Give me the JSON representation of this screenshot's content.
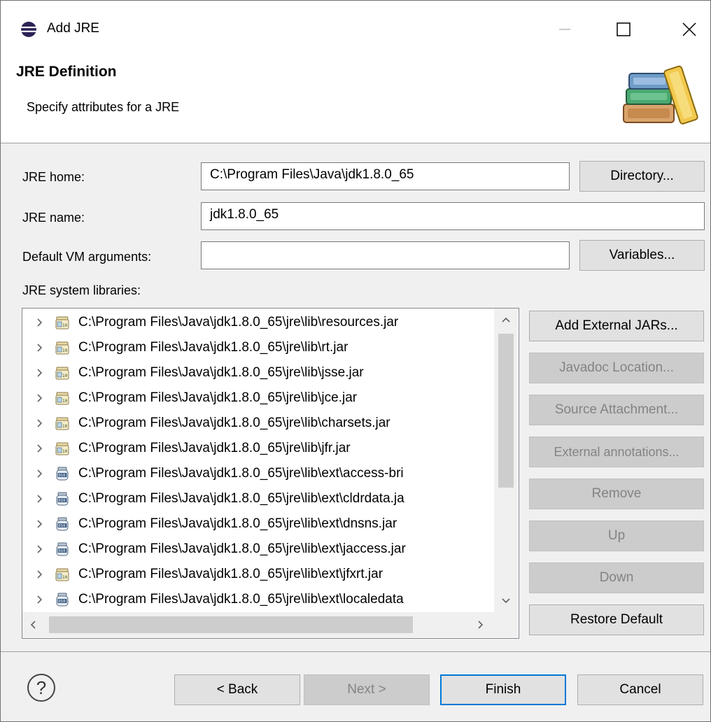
{
  "window": {
    "title": "Add JRE",
    "icon": "eclipse-icon"
  },
  "banner": {
    "title": "JRE Definition",
    "description": "Specify attributes for a JRE",
    "art": "books-icon"
  },
  "form": {
    "jre_home_label": "JRE home:",
    "jre_home_value": "C:\\Program Files\\Java\\jdk1.8.0_65",
    "directory_button": "Directory...",
    "jre_name_label": "JRE name:",
    "jre_name_value": "jdk1.8.0_65",
    "vm_args_label": "Default VM arguments:",
    "vm_args_value": "",
    "variables_button": "Variables...",
    "libraries_label": "JRE system libraries:"
  },
  "libraries": [
    {
      "path": "C:\\Program Files\\Java\\jdk1.8.0_65\\jre\\lib\\resources.jar",
      "icon": "jar-folder"
    },
    {
      "path": "C:\\Program Files\\Java\\jdk1.8.0_65\\jre\\lib\\rt.jar",
      "icon": "jar-folder"
    },
    {
      "path": "C:\\Program Files\\Java\\jdk1.8.0_65\\jre\\lib\\jsse.jar",
      "icon": "jar-folder"
    },
    {
      "path": "C:\\Program Files\\Java\\jdk1.8.0_65\\jre\\lib\\jce.jar",
      "icon": "jar-folder"
    },
    {
      "path": "C:\\Program Files\\Java\\jdk1.8.0_65\\jre\\lib\\charsets.jar",
      "icon": "jar-folder"
    },
    {
      "path": "C:\\Program Files\\Java\\jdk1.8.0_65\\jre\\lib\\jfr.jar",
      "icon": "jar-folder"
    },
    {
      "path": "C:\\Program Files\\Java\\jdk1.8.0_65\\jre\\lib\\ext\\access-bri",
      "icon": "jar-binary"
    },
    {
      "path": "C:\\Program Files\\Java\\jdk1.8.0_65\\jre\\lib\\ext\\cldrdata.ja",
      "icon": "jar-binary"
    },
    {
      "path": "C:\\Program Files\\Java\\jdk1.8.0_65\\jre\\lib\\ext\\dnsns.jar",
      "icon": "jar-binary"
    },
    {
      "path": "C:\\Program Files\\Java\\jdk1.8.0_65\\jre\\lib\\ext\\jaccess.jar",
      "icon": "jar-binary"
    },
    {
      "path": "C:\\Program Files\\Java\\jdk1.8.0_65\\jre\\lib\\ext\\jfxrt.jar",
      "icon": "jar-folder"
    },
    {
      "path": "C:\\Program Files\\Java\\jdk1.8.0_65\\jre\\lib\\ext\\localedata",
      "icon": "jar-binary"
    }
  ],
  "side_buttons": {
    "add_external_jars": "Add External JARs...",
    "javadoc_location": "Javadoc Location...",
    "source_attachment": "Source Attachment...",
    "external_annotations": "External annotations...",
    "remove": "Remove",
    "up": "Up",
    "down": "Down",
    "restore_default": "Restore Default"
  },
  "footer": {
    "help": "?",
    "back": "< Back",
    "next": "Next >",
    "finish": "Finish",
    "cancel": "Cancel"
  },
  "colors": {
    "accent": "#0078d7",
    "disabled_text": "#838383",
    "button_face": "#e1e1e1"
  }
}
